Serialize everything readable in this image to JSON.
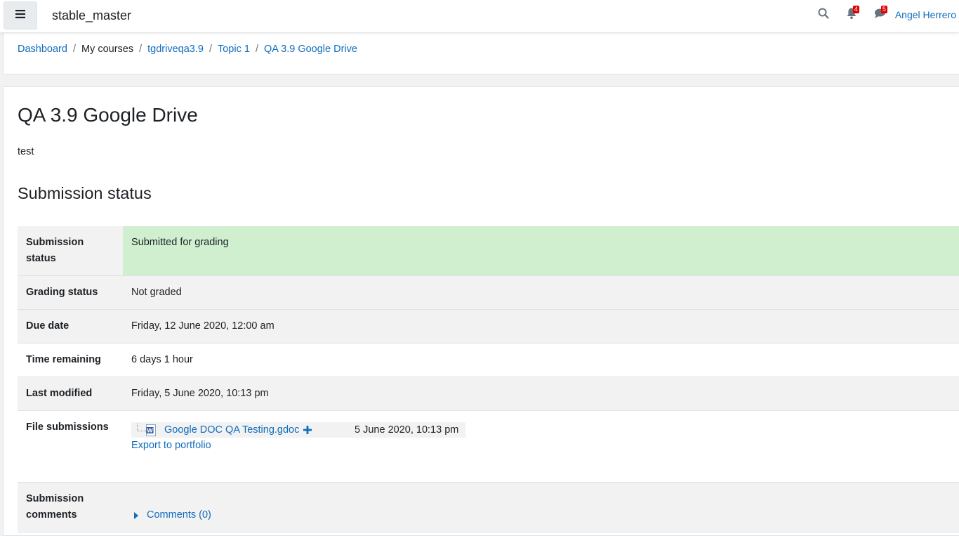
{
  "navbar": {
    "site_name": "stable_master",
    "notifications_count": "4",
    "messages_count": "5",
    "user_name": "Angel Herrero"
  },
  "breadcrumb": {
    "items": [
      "Dashboard",
      "My courses",
      "tgdriveqa3.9",
      "Topic 1",
      "QA 3.9 Google Drive"
    ]
  },
  "page": {
    "title": "QA 3.9 Google Drive",
    "intro": "test",
    "section_title": "Submission status"
  },
  "status_table": {
    "rows": [
      {
        "label": "Submission status",
        "value": "Submitted for grading"
      },
      {
        "label": "Grading status",
        "value": "Not graded"
      },
      {
        "label": "Due date",
        "value": "Friday, 12 June 2020, 12:00 am"
      },
      {
        "label": "Time remaining",
        "value": "6 days 1 hour"
      },
      {
        "label": "Last modified",
        "value": "Friday, 5 June 2020, 10:13 pm"
      },
      {
        "label": "File submissions",
        "file_name": "Google DOC QA Testing.gdoc",
        "file_date": "5 June 2020, 10:13 pm",
        "export_label": "Export to portfolio"
      },
      {
        "label": "Submission comments",
        "comments_label": "Comments (0)"
      }
    ]
  },
  "colors": {
    "link": "#0f6cbf",
    "submitted_bg": "#cfefcf",
    "badge": "#e00000",
    "icon_gray": "#6a737b",
    "word_blue": "#2b579a"
  },
  "icons": {
    "menu": "hamburger-icon",
    "search": "search-icon",
    "notifications": "bell-icon",
    "messages": "speech-bubble-icon",
    "file_type": "word-document-icon",
    "add": "plus-icon",
    "expand": "caret-right-icon"
  }
}
